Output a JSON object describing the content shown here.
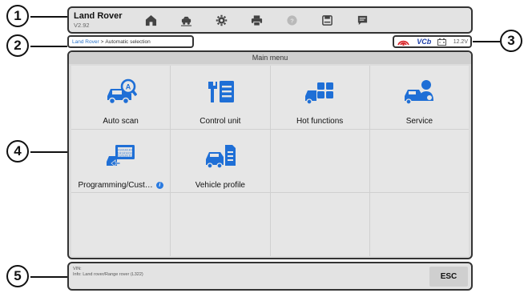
{
  "topbar": {
    "brand_name": "Land Rover",
    "version": "V2.92",
    "buttons": [
      "home-icon",
      "vehicle-swap-icon",
      "gear-icon",
      "printer-icon",
      "help-icon",
      "save-icon",
      "chat-icon"
    ]
  },
  "breadcrumb": {
    "link": "Land Rover",
    "separator": ">",
    "current": "Automatic selection"
  },
  "status": {
    "vci_label": "VCb",
    "voltage": "12.2V"
  },
  "main_menu": {
    "title": "Main menu",
    "tiles": [
      {
        "label": "Auto scan",
        "icon": "auto-scan-icon"
      },
      {
        "label": "Control unit",
        "icon": "control-unit-icon"
      },
      {
        "label": "Hot functions",
        "icon": "hot-functions-icon"
      },
      {
        "label": "Service",
        "icon": "service-icon"
      },
      {
        "label": "Programming/Cust…",
        "icon": "programming-icon"
      },
      {
        "label": "Vehicle profile",
        "icon": "vehicle-profile-icon"
      }
    ]
  },
  "bottombar": {
    "vin": "VIN:",
    "info": "Info: Land rover/Range rover (L322)",
    "esc_label": "ESC"
  },
  "callouts": [
    "1",
    "2",
    "3",
    "4",
    "5"
  ],
  "colors": {
    "accent_blue": "#2b7be0",
    "icon_blue": "#1f6fd6",
    "link_blue": "#2a73c9",
    "vcb_blue": "#1d3fa8",
    "signal_red": "#d8262a"
  }
}
